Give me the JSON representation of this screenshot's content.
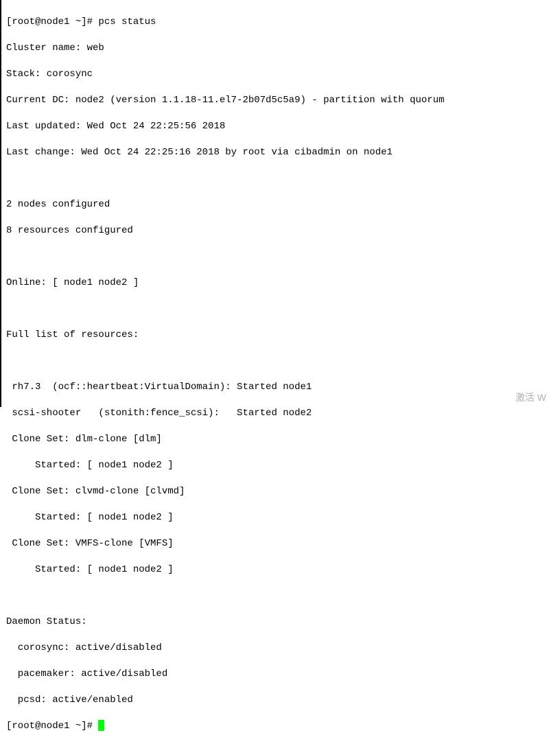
{
  "prompt1": "[root@node1 ~]# ",
  "command": "pcs status",
  "cluster_name_line": "Cluster name: web",
  "stack_line": "Stack: corosync",
  "current_dc_line": "Current DC: node2 (version 1.1.18-11.el7-2b07d5c5a9) - partition with quorum",
  "last_updated_line": "Last updated: Wed Oct 24 22:25:56 2018",
  "last_change_line": "Last change: Wed Oct 24 22:25:16 2018 by root via cibadmin on node1",
  "nodes_configured_line": "2 nodes configured",
  "resources_configured_line": "8 resources configured",
  "online_line": "Online: [ node1 node2 ]",
  "full_list_header": "Full list of resources:",
  "resource_rh73": " rh7.3  (ocf::heartbeat:VirtualDomain): Started node1",
  "resource_scsi": " scsi-shooter   (stonith:fence_scsi):   Started node2",
  "clone_dlm_header": " Clone Set: dlm-clone [dlm]",
  "clone_dlm_started": "     Started: [ node1 node2 ]",
  "clone_clvmd_header": " Clone Set: clvmd-clone [clvmd]",
  "clone_clvmd_started": "     Started: [ node1 node2 ]",
  "clone_vmfs_header": " Clone Set: VMFS-clone [VMFS]",
  "clone_vmfs_started": "     Started: [ node1 node2 ]",
  "daemon_header": "Daemon Status:",
  "daemon_corosync": "  corosync: active/disabled",
  "daemon_pacemaker": "  pacemaker: active/disabled",
  "daemon_pcsd": "  pcsd: active/enabled",
  "prompt2": "[root@node1 ~]# ",
  "watermark": "激活 W"
}
